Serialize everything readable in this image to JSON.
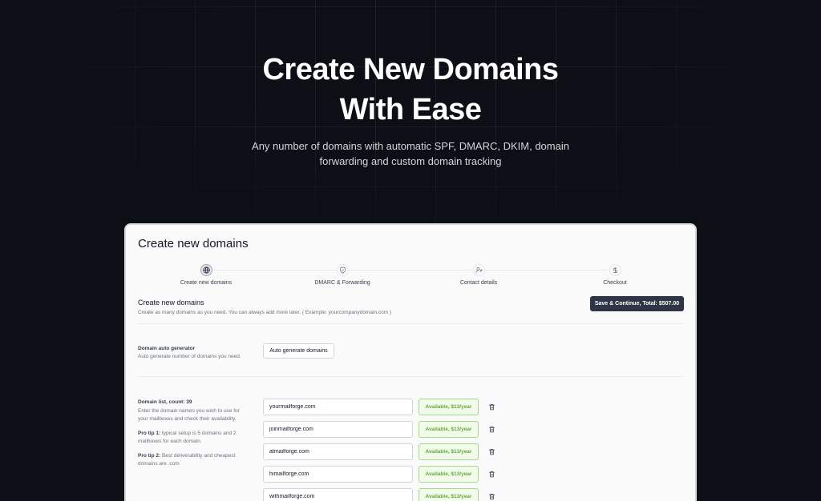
{
  "hero": {
    "title_line1": "Create New Domains",
    "title_line2": "With Ease",
    "subtitle_line1": "Any number of domains with automatic SPF, DMARC, DKIM, domain",
    "subtitle_line2": "forwarding and custom domain tracking"
  },
  "card": {
    "title": "Create new domains",
    "steps": [
      {
        "label": "Create new domains",
        "icon": "globe-icon",
        "active": true
      },
      {
        "label": "DMARC & Forwarding",
        "icon": "shield-icon",
        "active": false
      },
      {
        "label": "Contact details",
        "icon": "user-edit-icon",
        "active": false
      },
      {
        "label": "Checkout",
        "icon": "dollar-icon",
        "active": false
      }
    ],
    "section_title": "Create new domains",
    "section_desc": "Create as many domains as you need. You can always add more later. ( Example: yourcompanydomain.com )",
    "save_button": "Save & Continue, Total: $507.00",
    "auto_gen": {
      "title": "Domain auto generator",
      "desc": "Auto generate number of domains you need.",
      "button": "Auto generate domains"
    },
    "domain_list": {
      "title": "Domain list, count: 39",
      "desc_line1": "Enter the domain names you wish to use for",
      "desc_line2": "your mailboxes and check their availability.",
      "tip1_label": "Pro tip 1:",
      "tip1_line1": " typical setup is 5 domains and 2",
      "tip1_line2": "mailboxes for each domain.",
      "tip2_label": "Pro tip 2:",
      "tip2_line1": " Best deliverability and cheapest",
      "tip2_line2": "domains are .com",
      "domains": [
        {
          "name": "yourmailforge.com",
          "status": "Available, $13/year"
        },
        {
          "name": "joinmailforge.com",
          "status": "Available, $13/year"
        },
        {
          "name": "atmailforge.com",
          "status": "Available, $13/year"
        },
        {
          "name": "himailforge.com",
          "status": "Available, $13/year"
        },
        {
          "name": "withmailforge.com",
          "status": "Available, $13/year"
        }
      ]
    }
  },
  "colors": {
    "background": "#0d0f16",
    "primary_button": "#2e3645",
    "available_text": "#65a83e",
    "available_bg": "#f1fbe9"
  }
}
